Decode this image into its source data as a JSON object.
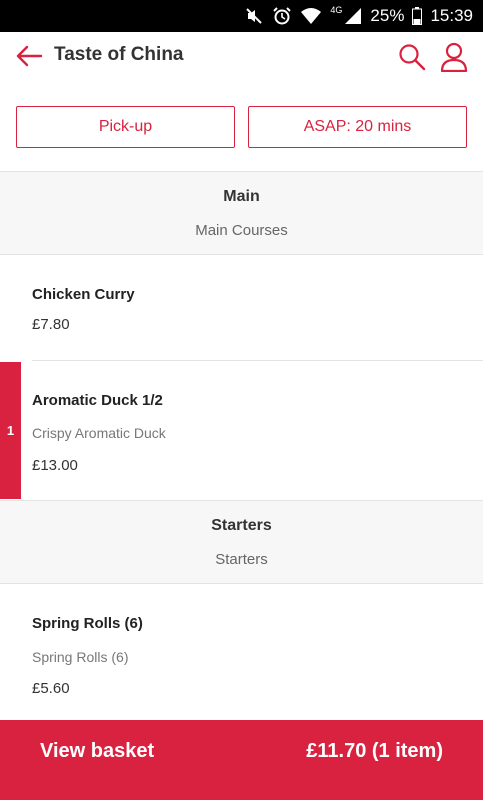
{
  "status_bar": {
    "network": "4G",
    "battery": "25%",
    "time": "15:39"
  },
  "header": {
    "title": "Taste of China"
  },
  "order_options": {
    "pickup_label": "Pick-up",
    "time_label": "ASAP: 20 mins"
  },
  "sections": [
    {
      "title": "Main",
      "subtitle": "Main Courses",
      "items": [
        {
          "name": "Chicken Curry",
          "description": "",
          "price": "£7.80"
        },
        {
          "name": "Aromatic Duck 1/2",
          "description": "Crispy Aromatic Duck",
          "price": "£13.00",
          "quantity": "1"
        }
      ]
    },
    {
      "title": "Starters",
      "subtitle": "Starters",
      "items": [
        {
          "name": "Spring Rolls (6)",
          "description": "Spring Rolls (6)",
          "price": "£5.60"
        }
      ]
    }
  ],
  "basket": {
    "label": "View basket",
    "total": "£11.70 (1 item)"
  },
  "colors": {
    "accent": "#d9223f",
    "status_bar": "#000000",
    "section_background": "#f7f7f7"
  }
}
